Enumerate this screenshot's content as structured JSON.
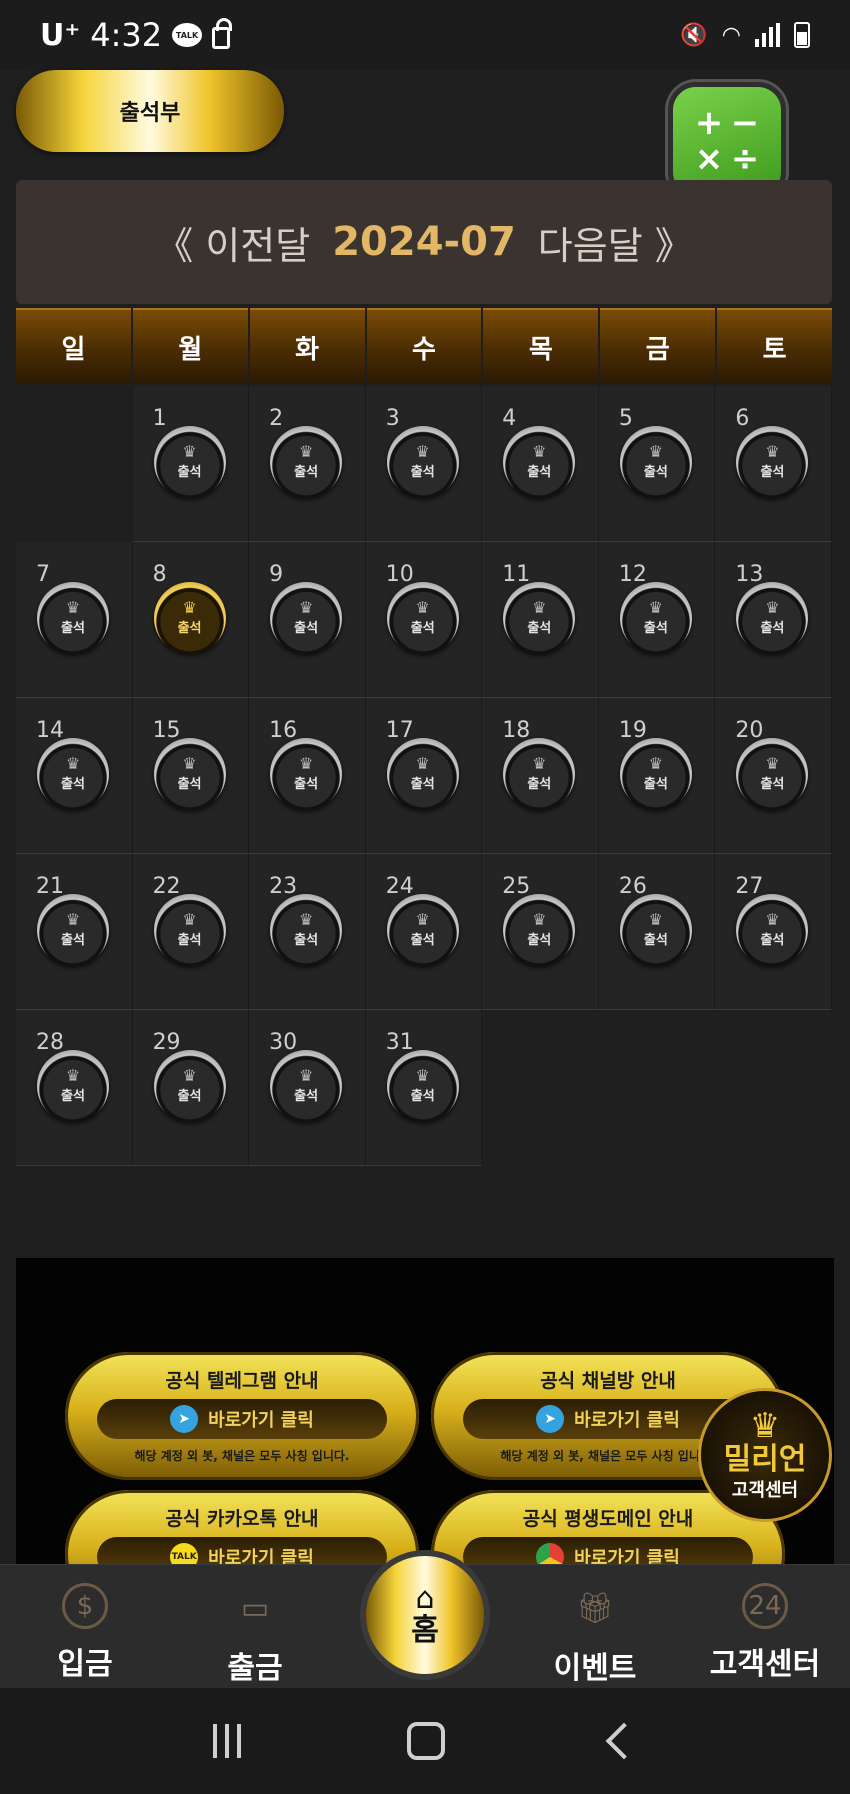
{
  "status_bar": {
    "carrier": "U⁺",
    "time": "4:32",
    "talk_badge": "TALK"
  },
  "header": {
    "attendance_label": "출석부",
    "calculator_symbols": [
      "+",
      "−",
      "×",
      "÷"
    ]
  },
  "month_nav": {
    "prev_label": "《 이전달",
    "month": "2024-07",
    "next_label": "다음달 》"
  },
  "weekdays": [
    "일",
    "월",
    "화",
    "수",
    "목",
    "금",
    "토"
  ],
  "calendar": {
    "first_weekday_index": 1,
    "days_in_month": 31,
    "attended_day": 8,
    "stamp_label": "출석",
    "crown_glyph": "♛"
  },
  "banners": [
    {
      "title": "공식 텔레그램 안내",
      "button": "바로가기 클릭",
      "icon": "telegram-icon",
      "note": "해당 계정 외 봇, 채널은 모두 사칭 입니다."
    },
    {
      "title": "공식 채널방 안내",
      "button": "바로가기 클릭",
      "icon": "telegram-icon",
      "note": "해당 계정 외 봇, 채널은 모두 사칭 입니다."
    },
    {
      "title": "공식 카카오톡 안내",
      "button": "바로가기 클릭",
      "icon": "kakao-icon",
      "note": ""
    },
    {
      "title": "공식 평생도메인 안내",
      "button": "바로가기 클릭",
      "icon": "chrome-icon",
      "note": ""
    }
  ],
  "support_badge": {
    "brand": "밀리언",
    "subtitle": "고객센터"
  },
  "bottom_nav": {
    "deposit": "입금",
    "withdraw": "출금",
    "home": "홈",
    "event": "이벤트",
    "support": "고객센터",
    "deposit_icon": "$",
    "support_icon": "24"
  },
  "colors": {
    "gold": "#e2b867",
    "calculator_green": "#4caf2a",
    "background": "#1f1f1f"
  }
}
